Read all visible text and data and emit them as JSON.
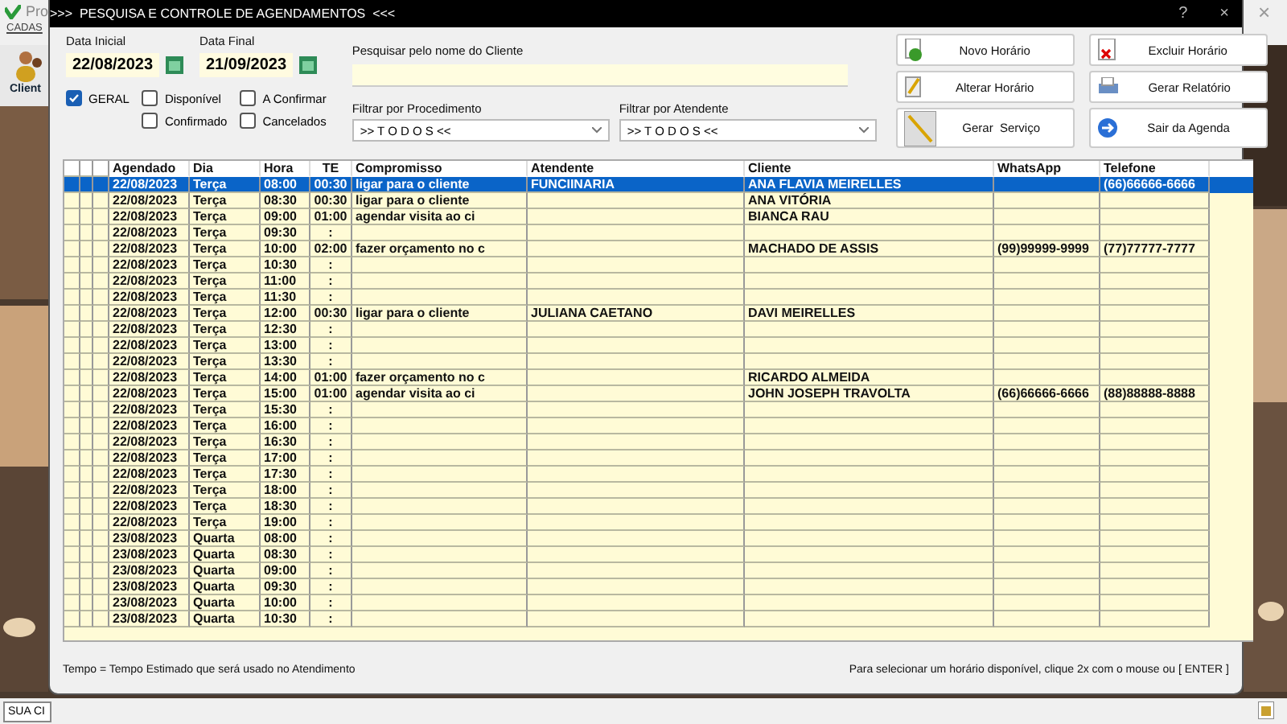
{
  "background_app": {
    "title": "Pro",
    "menu": "CADAS",
    "toolbar_label": "Client",
    "status_field": "SUA CI"
  },
  "window": {
    "title": ">>>  PESQUISA E CONTROLE DE AGENDAMENTOS  <<<",
    "help": "?",
    "close": "×"
  },
  "filters": {
    "date_start": {
      "label": "Data Inicial",
      "value": "22/08/2023"
    },
    "date_end": {
      "label": "Data Final",
      "value": "21/09/2023"
    },
    "checkboxes": [
      {
        "label": "GERAL",
        "checked": true
      },
      {
        "label": "Disponível",
        "checked": false
      },
      {
        "label": "A Confirmar",
        "checked": false
      },
      {
        "label": "Confirmado",
        "checked": false
      },
      {
        "label": "Cancelados",
        "checked": false
      }
    ],
    "search": {
      "label": "Pesquisar pelo nome do Cliente"
    },
    "procedure": {
      "label": "Filtrar por Procedimento",
      "value": ">> T O D O S <<"
    },
    "attendant": {
      "label": "Filtrar por Atendente",
      "value": ">> T O D O S <<"
    }
  },
  "buttons": [
    {
      "label": "Novo Horário",
      "kind": "new"
    },
    {
      "label": "Excluir Horário",
      "kind": "delete"
    },
    {
      "label": "Alterar Horário",
      "kind": "edit"
    },
    {
      "label": "Gerar Relatório",
      "kind": "print"
    },
    {
      "label": "Gerar  Serviço",
      "kind": "service"
    },
    {
      "label": "Sair da Agenda",
      "kind": "exit"
    }
  ],
  "table": {
    "columns": [
      "Agendado",
      "Dia",
      "Hora",
      "TE",
      "Compromisso",
      "Atendente",
      "Cliente",
      "WhatsApp",
      "Telefone"
    ],
    "rows": [
      {
        "agendado": "22/08/2023",
        "dia": "Terça",
        "hora": "08:00",
        "te": "00:30",
        "compromisso": "ligar para o cliente",
        "atendente": "FUNCIINARIA",
        "cliente": "ANA FLAVIA MEIRELLES",
        "telefone": "(66)66666-6666",
        "selected": true
      },
      {
        "agendado": "22/08/2023",
        "dia": "Terça",
        "hora": "08:30",
        "te": "00:30",
        "compromisso": "ligar para o cliente",
        "cliente": "ANA VITÓRIA",
        "selected": false
      },
      {
        "agendado": "22/08/2023",
        "dia": "Terça",
        "hora": "09:00",
        "te": "01:00",
        "compromisso": "agendar visita ao ci",
        "cliente": "BIANCA RAU",
        "selected": false
      },
      {
        "agendado": "22/08/2023",
        "dia": "Terça",
        "hora": "09:30",
        "te": ":",
        "selected": false
      },
      {
        "agendado": "22/08/2023",
        "dia": "Terça",
        "hora": "10:00",
        "te": "02:00",
        "compromisso": "fazer orçamento no c",
        "cliente": "MACHADO DE ASSIS",
        "whatsapp": "(99)99999-9999",
        "telefone": "(77)77777-7777",
        "selected": false
      },
      {
        "agendado": "22/08/2023",
        "dia": "Terça",
        "hora": "10:30",
        "te": ":",
        "selected": false
      },
      {
        "agendado": "22/08/2023",
        "dia": "Terça",
        "hora": "11:00",
        "te": ":",
        "selected": false
      },
      {
        "agendado": "22/08/2023",
        "dia": "Terça",
        "hora": "11:30",
        "te": ":",
        "selected": false
      },
      {
        "agendado": "22/08/2023",
        "dia": "Terça",
        "hora": "12:00",
        "te": "00:30",
        "compromisso": "ligar para o cliente",
        "atendente": "JULIANA CAETANO",
        "cliente": "DAVI MEIRELLES",
        "selected": false
      },
      {
        "agendado": "22/08/2023",
        "dia": "Terça",
        "hora": "12:30",
        "te": ":",
        "selected": false
      },
      {
        "agendado": "22/08/2023",
        "dia": "Terça",
        "hora": "13:00",
        "te": ":",
        "selected": false
      },
      {
        "agendado": "22/08/2023",
        "dia": "Terça",
        "hora": "13:30",
        "te": ":",
        "selected": false
      },
      {
        "agendado": "22/08/2023",
        "dia": "Terça",
        "hora": "14:00",
        "te": "01:00",
        "compromisso": "fazer orçamento no c",
        "cliente": "RICARDO ALMEIDA",
        "selected": false
      },
      {
        "agendado": "22/08/2023",
        "dia": "Terça",
        "hora": "15:00",
        "te": "01:00",
        "compromisso": "agendar visita ao ci",
        "cliente": "JOHN JOSEPH TRAVOLTA",
        "whatsapp": "(66)66666-6666",
        "telefone": "(88)88888-8888",
        "selected": false
      },
      {
        "agendado": "22/08/2023",
        "dia": "Terça",
        "hora": "15:30",
        "te": ":",
        "selected": false
      },
      {
        "agendado": "22/08/2023",
        "dia": "Terça",
        "hora": "16:00",
        "te": ":",
        "selected": false
      },
      {
        "agendado": "22/08/2023",
        "dia": "Terça",
        "hora": "16:30",
        "te": ":",
        "selected": false
      },
      {
        "agendado": "22/08/2023",
        "dia": "Terça",
        "hora": "17:00",
        "te": ":",
        "selected": false
      },
      {
        "agendado": "22/08/2023",
        "dia": "Terça",
        "hora": "17:30",
        "te": ":",
        "selected": false
      },
      {
        "agendado": "22/08/2023",
        "dia": "Terça",
        "hora": "18:00",
        "te": ":",
        "selected": false
      },
      {
        "agendado": "22/08/2023",
        "dia": "Terça",
        "hora": "18:30",
        "te": ":",
        "selected": false
      },
      {
        "agendado": "22/08/2023",
        "dia": "Terça",
        "hora": "19:00",
        "te": ":",
        "selected": false
      },
      {
        "agendado": "23/08/2023",
        "dia": "Quarta",
        "hora": "08:00",
        "te": ":",
        "selected": false
      },
      {
        "agendado": "23/08/2023",
        "dia": "Quarta",
        "hora": "08:30",
        "te": ":",
        "selected": false
      },
      {
        "agendado": "23/08/2023",
        "dia": "Quarta",
        "hora": "09:00",
        "te": ":",
        "selected": false
      },
      {
        "agendado": "23/08/2023",
        "dia": "Quarta",
        "hora": "09:30",
        "te": ":",
        "selected": false
      },
      {
        "agendado": "23/08/2023",
        "dia": "Quarta",
        "hora": "10:00",
        "te": ":",
        "selected": false
      },
      {
        "agendado": "23/08/2023",
        "dia": "Quarta",
        "hora": "10:30",
        "te": ":",
        "selected": false
      }
    ]
  },
  "footer": {
    "left": "Tempo = Tempo Estimado que será usado no Atendimento",
    "right": "Para selecionar um horário disponível, clique 2x com o mouse ou [ ENTER ]"
  }
}
